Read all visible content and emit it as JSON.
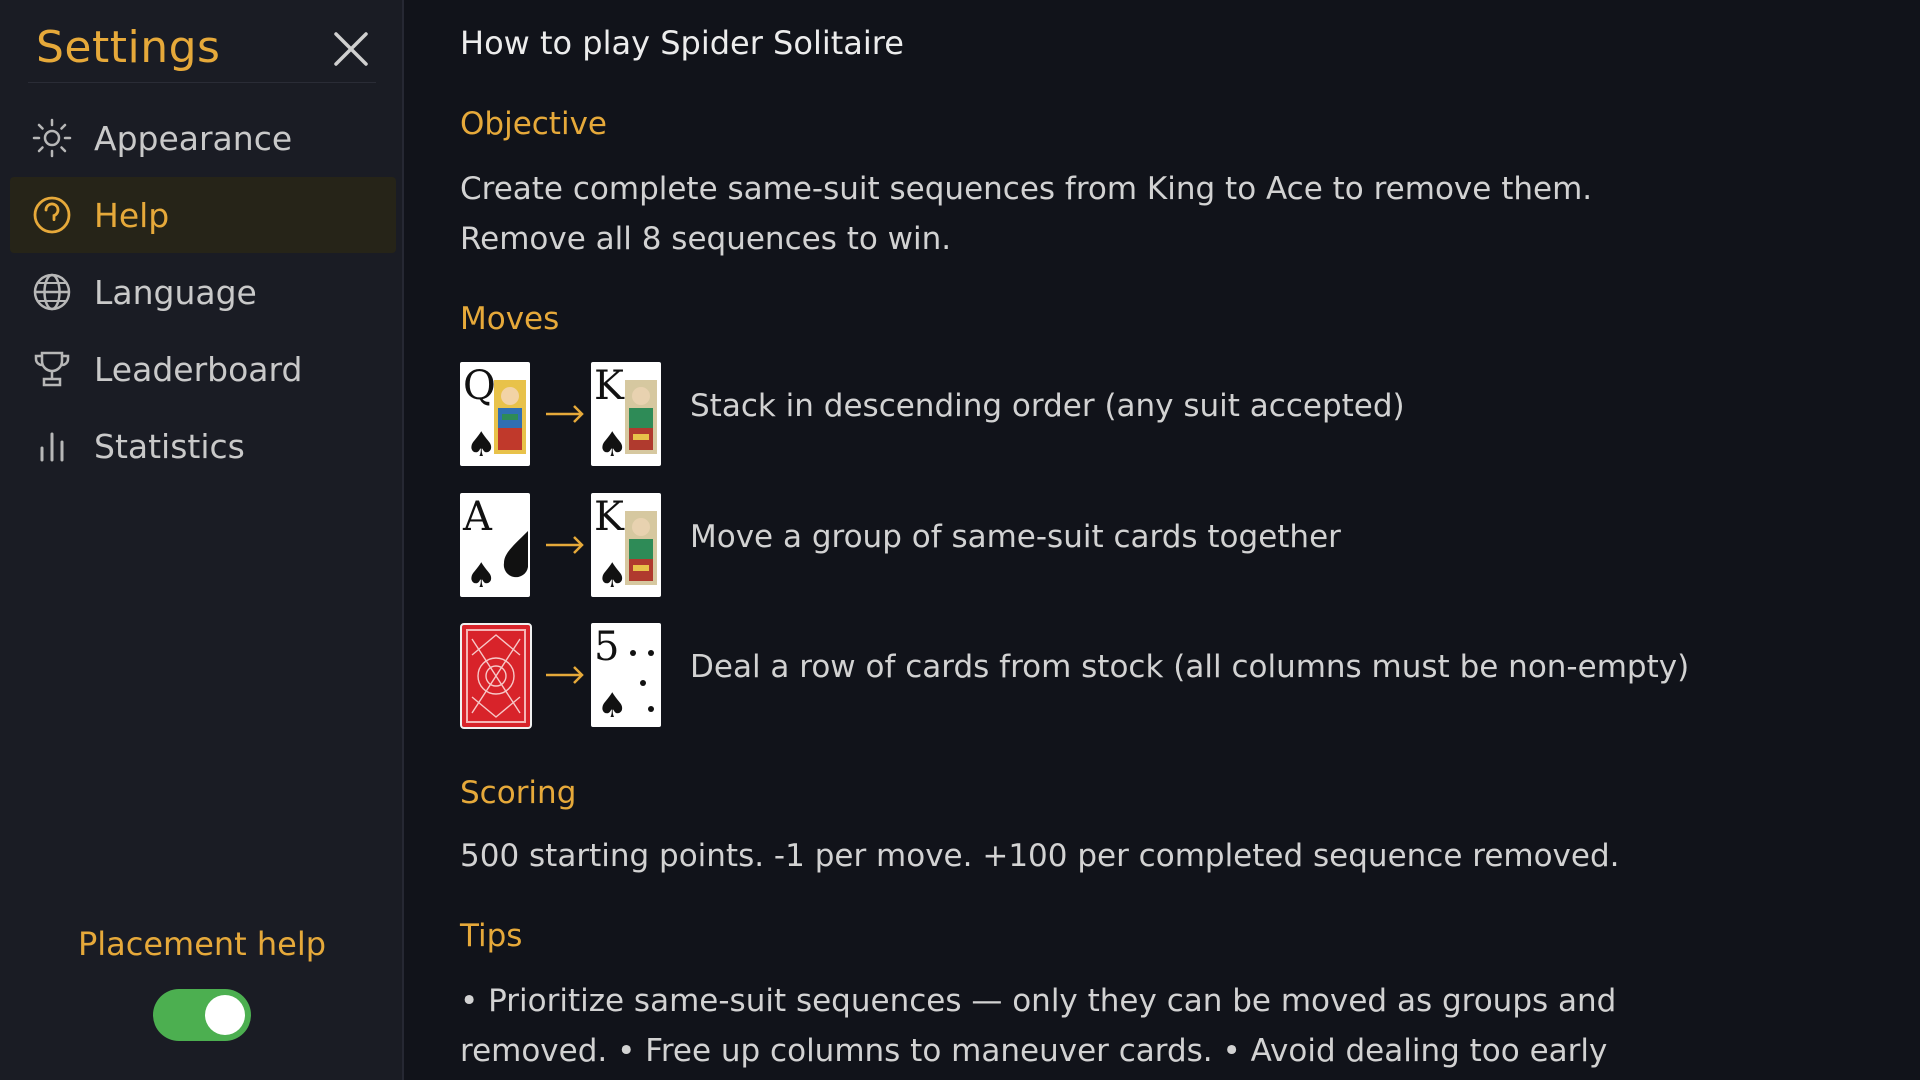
{
  "sidebar": {
    "title": "Settings",
    "items": [
      {
        "label": "Appearance",
        "icon": "sun-icon"
      },
      {
        "label": "Help",
        "icon": "help-icon"
      },
      {
        "label": "Language",
        "icon": "globe-icon"
      },
      {
        "label": "Leaderboard",
        "icon": "trophy-icon"
      },
      {
        "label": "Statistics",
        "icon": "bar-chart-icon"
      }
    ],
    "active_item": "Help",
    "placement_help": {
      "label": "Placement help",
      "enabled": true
    }
  },
  "help": {
    "title": "How to play Spider Solitaire",
    "objective": {
      "heading": "Objective",
      "lines": [
        "Create complete same-suit sequences from King to Ace to remove them.",
        "Remove all 8 sequences to win."
      ]
    },
    "moves": {
      "heading": "Moves",
      "rows": [
        {
          "from": {
            "rank": "Q",
            "suit": "♠"
          },
          "to": {
            "rank": "K",
            "suit": "♠"
          },
          "text": "Stack in descending order (any suit accepted)"
        },
        {
          "from": {
            "rank": "A",
            "suit": "♠"
          },
          "to": {
            "rank": "K",
            "suit": "♠"
          },
          "text": "Move a group of same-suit cards together"
        },
        {
          "from": {
            "rank": "",
            "suit": "",
            "card_back": true
          },
          "to": {
            "rank": "5",
            "suit": "♠"
          },
          "text": "Deal a row of cards from stock (all columns must be non-empty)"
        }
      ]
    },
    "scoring": {
      "heading": "Scoring",
      "text": "500 starting points. -1 per move. +100 per completed sequence removed."
    },
    "tips": {
      "heading": "Tips",
      "lines": [
        "• Prioritize same-suit sequences — only they can be moved as groups and",
        "removed. • Free up columns to maneuver cards. • Avoid dealing too early"
      ]
    }
  },
  "colors": {
    "accent": "#e6a93a",
    "background": "#11131a",
    "sidebar": "#1a1c24",
    "toggle_on": "#4caf50",
    "card_back": "#d8232a"
  }
}
